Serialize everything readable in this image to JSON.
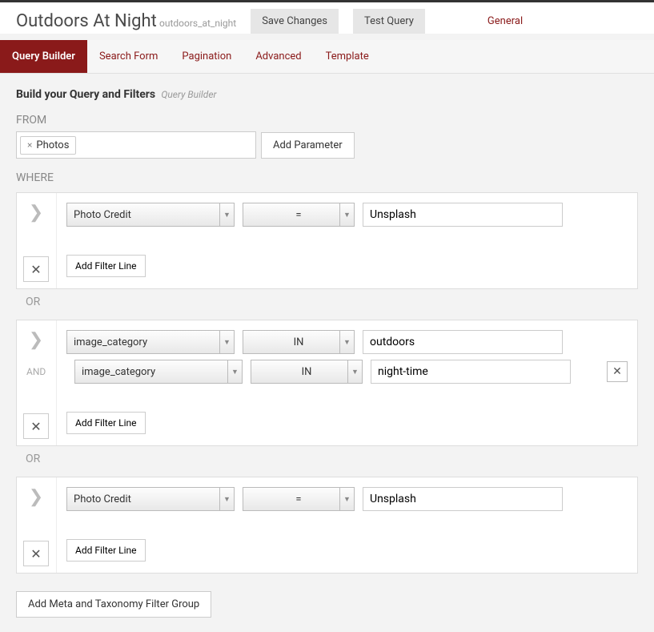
{
  "header": {
    "title": "Outdoors At Night",
    "slug": "outdoors_at_night",
    "save_label": "Save Changes",
    "test_label": "Test Query",
    "general_label": "General"
  },
  "tabs": [
    "Query Builder",
    "Search Form",
    "Pagination",
    "Advanced",
    "Template"
  ],
  "section": {
    "title": "Build your Query and Filters",
    "sub": "Query Builder"
  },
  "from": {
    "label": "FROM",
    "tag": "Photos",
    "add_param": "Add Parameter"
  },
  "where_label": "WHERE",
  "or_label": "OR",
  "and_label": "AND",
  "add_filter_label": "Add Filter Line",
  "add_group_label": "Add Meta and Taxonomy Filter Group",
  "groups": [
    {
      "rows": [
        {
          "field": "Photo Credit",
          "op": "=",
          "value": "Unsplash",
          "show_x": false
        }
      ]
    },
    {
      "rows": [
        {
          "field": "image_category",
          "op": "IN",
          "value": "outdoors",
          "show_x": false
        },
        {
          "field": "image_category",
          "op": "IN",
          "value": "night-time",
          "show_x": true
        }
      ]
    },
    {
      "rows": [
        {
          "field": "Photo Credit",
          "op": "=",
          "value": "Unsplash",
          "show_x": false
        }
      ]
    }
  ]
}
